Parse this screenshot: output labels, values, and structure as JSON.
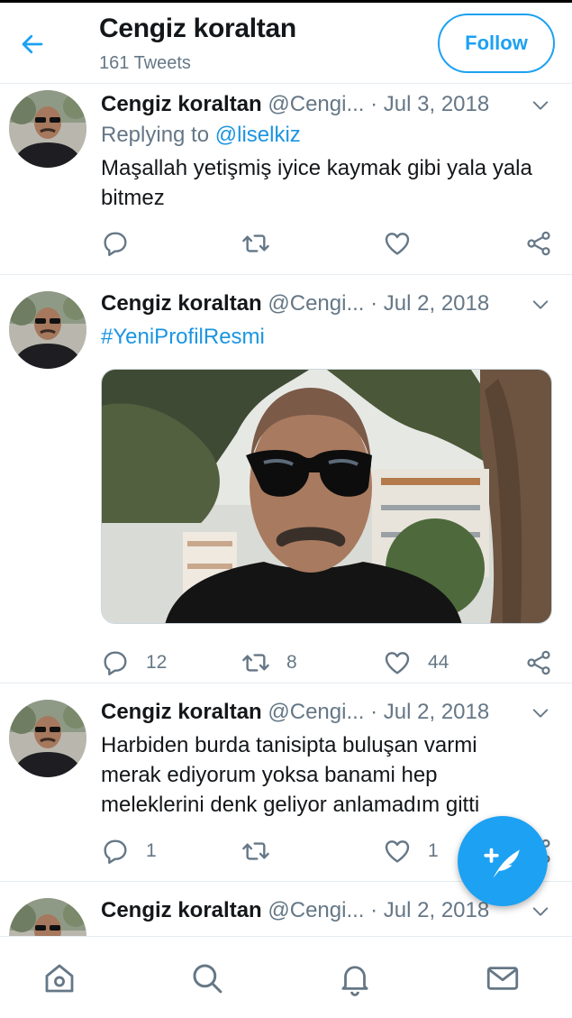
{
  "header": {
    "title": "Cengiz koraltan",
    "subtitle": "161 Tweets",
    "follow_label": "Follow"
  },
  "colors": {
    "accent": "#1da1f2",
    "link": "#1b95e0",
    "muted": "#657786",
    "text": "#14171a",
    "divider": "#e6ecf0"
  },
  "tweets": [
    {
      "name": "Cengiz koraltan",
      "handle": "@Cengi...",
      "dot": "·",
      "date": "Jul 3, 2018",
      "reply_prefix": "Replying to ",
      "reply_to": "@liselkiz",
      "text": "Maşallah yetişmiş iyice kaymak gibi yala yala bitmez",
      "replies": "",
      "retweets": "",
      "likes": ""
    },
    {
      "name": "Cengiz koraltan",
      "handle": "@Cengi...",
      "dot": "·",
      "date": "Jul 2, 2018",
      "hashtag": "#YeniProfilResmi",
      "replies": "12",
      "retweets": "8",
      "likes": "44"
    },
    {
      "name": "Cengiz koraltan",
      "handle": "@Cengi...",
      "dot": "·",
      "date": "Jul 2, 2018",
      "text": "Harbiden burda tanisipta buluşan varmi merak ediyorum yoksa banami hep meleklerini denk geliyor anlamadım  gitti",
      "replies": "1",
      "retweets": "",
      "likes": "1"
    },
    {
      "name": "Cengiz koraltan",
      "handle": "@Cengi...",
      "dot": "·",
      "date": "Jul 2, 2018"
    }
  ],
  "icons": {
    "back": "arrow-left-icon",
    "caret": "chevron-down-icon",
    "reply": "reply-icon",
    "retweet": "retweet-icon",
    "like": "heart-icon",
    "share": "share-icon",
    "compose": "compose-tweet-icon",
    "home": "home-icon",
    "search": "search-icon",
    "notifications": "bell-icon",
    "messages": "mail-icon"
  }
}
